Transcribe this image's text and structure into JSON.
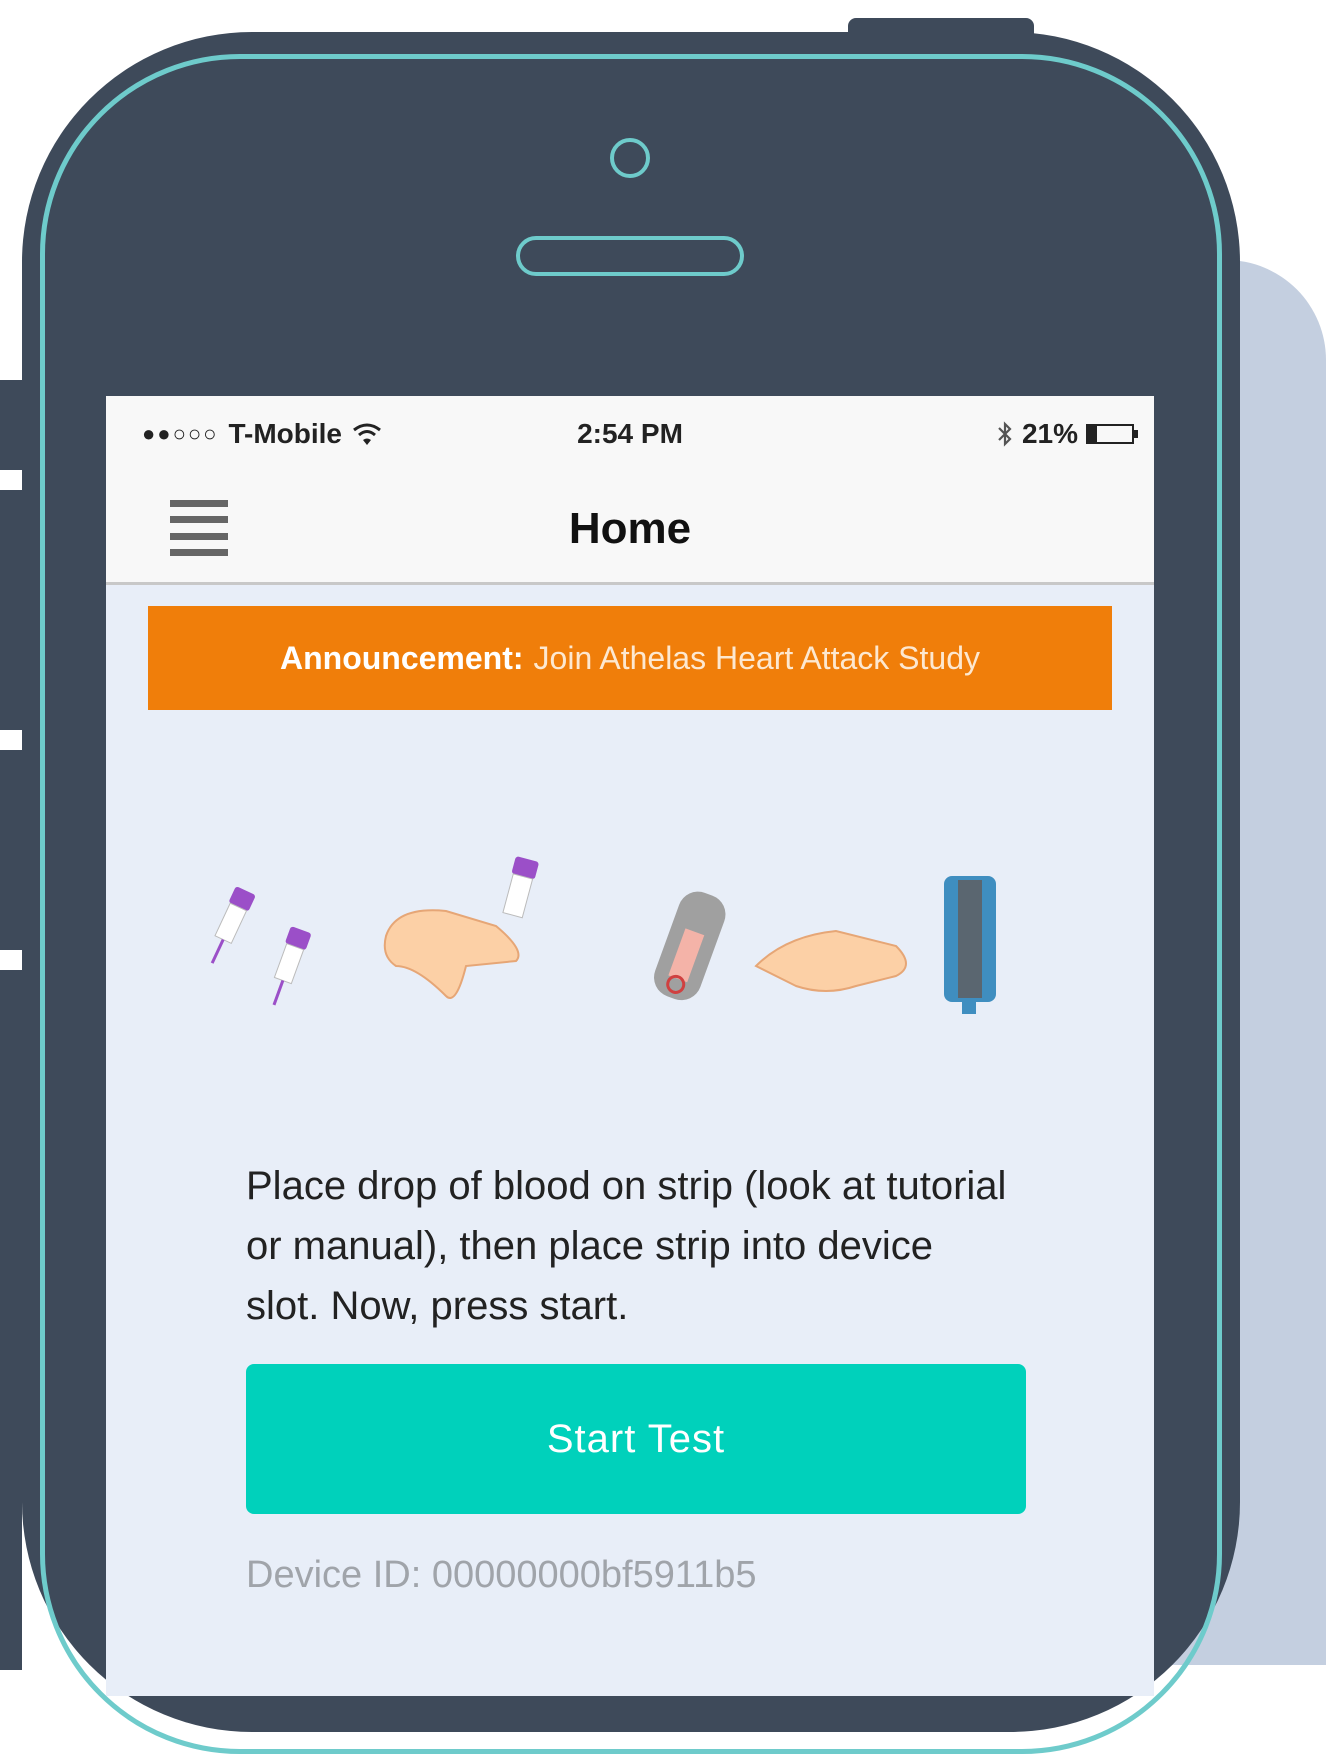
{
  "status_bar": {
    "signal_dots": "●●○○○",
    "carrier": "T-Mobile",
    "time": "2:54 PM",
    "battery": "21%",
    "battery_level": 0.21,
    "icons": [
      "wifi-icon",
      "bluetooth-icon",
      "battery-icon"
    ]
  },
  "navbar": {
    "title": "Home",
    "menu_icon": "hamburger-menu-icon"
  },
  "announcement": {
    "label": "Announcement:",
    "message": "Join Athelas Heart Attack Study",
    "color": "#f07e0a"
  },
  "illustration": {
    "icons": [
      "lancet-icon",
      "finger-prick-icon",
      "strip-insert-icon",
      "device-icon"
    ]
  },
  "instructions": "Place drop of blood on strip (look at tutorial or manual), then place strip into device slot. Now, press start.",
  "start_button": {
    "label": "Start Test",
    "color": "#00d1bb"
  },
  "device_id": "Device ID: 00000000bf5911b5"
}
